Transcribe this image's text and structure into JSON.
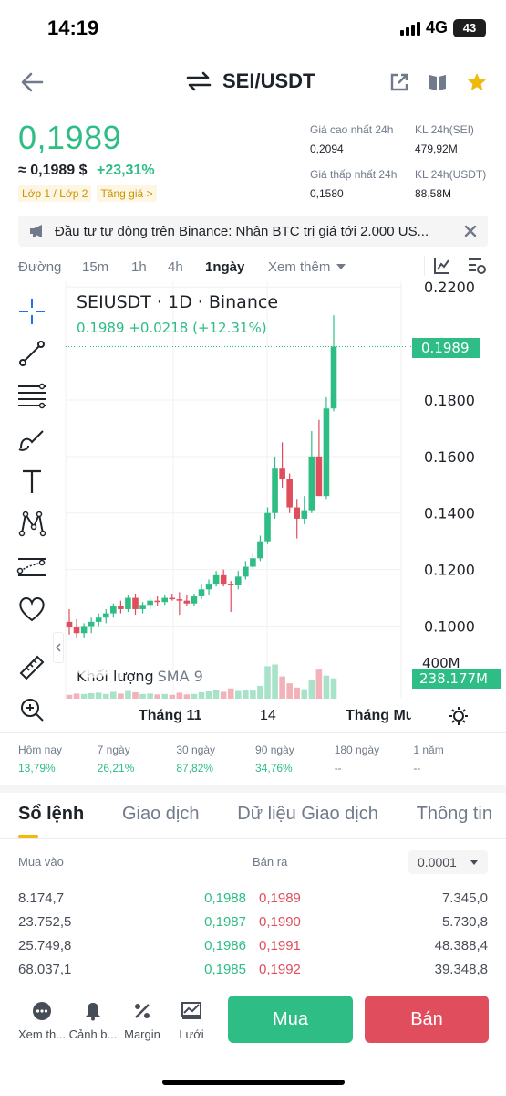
{
  "status": {
    "time": "14:19",
    "network": "4G",
    "battery": "43"
  },
  "nav": {
    "pair": "SEI/USDT",
    "icons": [
      "back-arrow-icon",
      "swap-arrows-icon",
      "share-external-icon",
      "book-icon",
      "star-icon"
    ]
  },
  "price": {
    "last": "0,1989",
    "approx_usd": "≈ 0,1989 $",
    "change_pct": "+23,31%",
    "tag_layer": "Lớp 1 / Lớp 2",
    "tag_gainer": "Tăng giá >"
  },
  "stats24h": {
    "high_label": "Giá cao nhất 24h",
    "high_value": "0,2094",
    "low_label": "Giá thấp nhất 24h",
    "low_value": "0,1580",
    "vol_sei_label": "KL 24h(SEI)",
    "vol_sei_value": "479,92M",
    "vol_usdt_label": "KL 24h(USDT)",
    "vol_usdt_value": "88,58M"
  },
  "banner": {
    "text": "Đầu tư tự động trên Binance: Nhận BTC trị giá tới 2.000 US..."
  },
  "timeframes": {
    "line": "Đường",
    "m15": "15m",
    "h1": "1h",
    "h4": "4h",
    "d1": "1ngày",
    "more": "Xem thêm"
  },
  "chart": {
    "title": "SEIUSDT · 1D · Binance",
    "subtitle": "0.1989  +0.0218 (+12.31%)",
    "price_tag": "0.1989",
    "volume_label": "Khối lượng",
    "sma_label": "SMA 9",
    "volume_tag": "238.177M",
    "vol_axis_label": "400M",
    "x_labels": [
      "Tháng 11",
      "14",
      "Tháng Mư"
    ],
    "up_color": "#2ebd85",
    "down_color": "#e04d5d"
  },
  "chart_data": {
    "type": "candlestick",
    "title": "SEIUSDT · 1D · Binance",
    "y_ticks": [
      "0.2200",
      "0.1800",
      "0.1600",
      "0.1400",
      "0.1200",
      "0.1000"
    ],
    "ylim": [
      0.0895,
      0.222
    ],
    "x_tick_labels": [
      "Tháng 11",
      "14",
      "Tháng Mư"
    ],
    "volume_ylim": [
      0,
      480
    ],
    "candles": [
      {
        "o": 0.1015,
        "h": 0.106,
        "l": 0.097,
        "c": 0.0995,
        "v": 45
      },
      {
        "o": 0.0995,
        "h": 0.1025,
        "l": 0.096,
        "c": 0.0975,
        "v": 60
      },
      {
        "o": 0.0975,
        "h": 0.101,
        "l": 0.096,
        "c": 0.1,
        "v": 55
      },
      {
        "o": 0.1,
        "h": 0.103,
        "l": 0.0975,
        "c": 0.1015,
        "v": 65
      },
      {
        "o": 0.1015,
        "h": 0.1045,
        "l": 0.1,
        "c": 0.103,
        "v": 70
      },
      {
        "o": 0.103,
        "h": 0.106,
        "l": 0.101,
        "c": 0.1045,
        "v": 55
      },
      {
        "o": 0.1045,
        "h": 0.108,
        "l": 0.103,
        "c": 0.107,
        "v": 80
      },
      {
        "o": 0.107,
        "h": 0.109,
        "l": 0.1045,
        "c": 0.106,
        "v": 60
      },
      {
        "o": 0.106,
        "h": 0.111,
        "l": 0.105,
        "c": 0.11,
        "v": 90
      },
      {
        "o": 0.11,
        "h": 0.1115,
        "l": 0.104,
        "c": 0.106,
        "v": 75
      },
      {
        "o": 0.106,
        "h": 0.1085,
        "l": 0.1045,
        "c": 0.1075,
        "v": 55
      },
      {
        "o": 0.1075,
        "h": 0.11,
        "l": 0.106,
        "c": 0.109,
        "v": 60
      },
      {
        "o": 0.109,
        "h": 0.1105,
        "l": 0.107,
        "c": 0.1085,
        "v": 50
      },
      {
        "o": 0.1085,
        "h": 0.111,
        "l": 0.1075,
        "c": 0.11,
        "v": 55
      },
      {
        "o": 0.11,
        "h": 0.1115,
        "l": 0.109,
        "c": 0.1095,
        "v": 45
      },
      {
        "o": 0.1095,
        "h": 0.112,
        "l": 0.104,
        "c": 0.109,
        "v": 70
      },
      {
        "o": 0.109,
        "h": 0.111,
        "l": 0.107,
        "c": 0.108,
        "v": 50
      },
      {
        "o": 0.108,
        "h": 0.1115,
        "l": 0.107,
        "c": 0.1105,
        "v": 55
      },
      {
        "o": 0.1105,
        "h": 0.115,
        "l": 0.1095,
        "c": 0.113,
        "v": 75
      },
      {
        "o": 0.113,
        "h": 0.1165,
        "l": 0.111,
        "c": 0.115,
        "v": 85
      },
      {
        "o": 0.115,
        "h": 0.1195,
        "l": 0.114,
        "c": 0.118,
        "v": 105
      },
      {
        "o": 0.118,
        "h": 0.12,
        "l": 0.114,
        "c": 0.115,
        "v": 80
      },
      {
        "o": 0.115,
        "h": 0.116,
        "l": 0.105,
        "c": 0.1145,
        "v": 120
      },
      {
        "o": 0.1145,
        "h": 0.1195,
        "l": 0.113,
        "c": 0.1175,
        "v": 90
      },
      {
        "o": 0.1175,
        "h": 0.123,
        "l": 0.1165,
        "c": 0.121,
        "v": 100
      },
      {
        "o": 0.121,
        "h": 0.126,
        "l": 0.12,
        "c": 0.124,
        "v": 95
      },
      {
        "o": 0.124,
        "h": 0.132,
        "l": 0.123,
        "c": 0.13,
        "v": 150
      },
      {
        "o": 0.13,
        "h": 0.142,
        "l": 0.129,
        "c": 0.14,
        "v": 380
      },
      {
        "o": 0.14,
        "h": 0.16,
        "l": 0.138,
        "c": 0.156,
        "v": 400
      },
      {
        "o": 0.156,
        "h": 0.165,
        "l": 0.149,
        "c": 0.152,
        "v": 260
      },
      {
        "o": 0.152,
        "h": 0.154,
        "l": 0.14,
        "c": 0.142,
        "v": 180
      },
      {
        "o": 0.142,
        "h": 0.145,
        "l": 0.131,
        "c": 0.138,
        "v": 130
      },
      {
        "o": 0.138,
        "h": 0.146,
        "l": 0.136,
        "c": 0.141,
        "v": 110
      },
      {
        "o": 0.141,
        "h": 0.169,
        "l": 0.14,
        "c": 0.16,
        "v": 220
      },
      {
        "o": 0.16,
        "h": 0.173,
        "l": 0.148,
        "c": 0.146,
        "v": 340
      },
      {
        "o": 0.146,
        "h": 0.181,
        "l": 0.145,
        "c": 0.177,
        "v": 270
      },
      {
        "o": 0.177,
        "h": 0.21,
        "l": 0.176,
        "c": 0.1989,
        "v": 238
      }
    ]
  },
  "perf": [
    {
      "label": "Hôm nay",
      "value": "13,79%"
    },
    {
      "label": "7 ngày",
      "value": "26,21%"
    },
    {
      "label": "30 ngày",
      "value": "87,82%"
    },
    {
      "label": "90 ngày",
      "value": "34,76%"
    },
    {
      "label": "180 ngày",
      "value": "--"
    },
    {
      "label": "1 năm",
      "value": "--"
    }
  ],
  "tabs": [
    "Sổ lệnh",
    "Giao dịch",
    "Dữ liệu Giao dịch",
    "Thông tin"
  ],
  "orderbook": {
    "bid_label": "Mua vào",
    "ask_label": "Bán ra",
    "precision": "0.0001",
    "rows": [
      {
        "bid_qty": "8.174,7",
        "bid_price": "0,1988",
        "ask_price": "0,1989",
        "ask_qty": "7.345,0"
      },
      {
        "bid_qty": "23.752,5",
        "bid_price": "0,1987",
        "ask_price": "0,1990",
        "ask_qty": "5.730,8"
      },
      {
        "bid_qty": "25.749,8",
        "bid_price": "0,1986",
        "ask_price": "0,1991",
        "ask_qty": "48.388,4"
      },
      {
        "bid_qty": "68.037,1",
        "bid_price": "0,1985",
        "ask_price": "0,1992",
        "ask_qty": "39.348,8"
      }
    ]
  },
  "bottom": {
    "more": "Xem th...",
    "alert": "Cảnh b...",
    "margin": "Margin",
    "grid": "Lưới",
    "buy": "Mua",
    "sell": "Bán"
  }
}
